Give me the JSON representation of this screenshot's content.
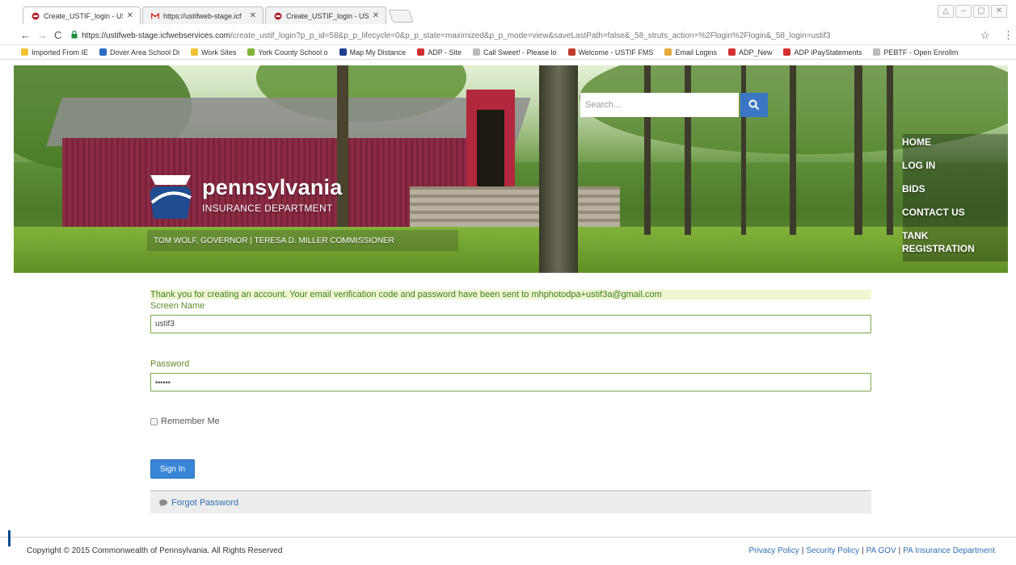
{
  "browser": {
    "tabs": [
      {
        "title": "Create_USTIF_login - UST",
        "icon": "site-favicon",
        "active": true
      },
      {
        "title": "https://ustifweb-stage.icf",
        "icon": "gmail-icon",
        "active": false
      },
      {
        "title": "Create_USTIF_login - UST",
        "icon": "site-favicon",
        "active": false
      }
    ],
    "url_host": "https://ustifweb-stage.icfwebservices.com",
    "url_path": "/create_ustif_login?p_p_id=58&p_p_lifecycle=0&p_p_state=maximized&p_p_mode=view&saveLastPath=false&_58_struts_action=%2Flogin%2Flogin&_58_login=ustif3",
    "bookmarks": [
      {
        "label": "Imported From IE",
        "color": "#f2c233"
      },
      {
        "label": "Dover Area School Di",
        "color": "#2b6cc4"
      },
      {
        "label": "Work Sites",
        "color": "#f2c233"
      },
      {
        "label": "York County School o",
        "color": "#7fb43a"
      },
      {
        "label": "Map My Distance",
        "color": "#1e3f8a"
      },
      {
        "label": "ADP - Site",
        "color": "#d32f2f"
      },
      {
        "label": "Call Sweet! - Please lo",
        "color": "#bbbbbb"
      },
      {
        "label": "Welcome - USTIF FMS",
        "color": "#c0392b"
      },
      {
        "label": "Email Logins",
        "color": "#e5a93c"
      },
      {
        "label": "ADP_New",
        "color": "#d32f2f"
      },
      {
        "label": "ADP iPayStatements",
        "color": "#d32f2f"
      },
      {
        "label": "PEBTF - Open Enrollm",
        "color": "#bbbbbb"
      }
    ]
  },
  "header": {
    "logo_word": "pennsylvania",
    "logo_sub": "INSURANCE DEPARTMENT",
    "governor_line": "TOM WOLF, GOVERNOR  |  TERESA D. MILLER COMMISSIONER",
    "search_placeholder": "Search...",
    "nav": [
      "HOME",
      "LOG IN",
      "BIDS",
      "CONTACT US",
      "TANK",
      "REGISTRATION"
    ]
  },
  "form": {
    "notice": "Thank you for creating an account. Your email verification code and password have been sent to mhphotodpa+ustif3a@gmail.com",
    "screen_name_label": "Screen Name",
    "screen_name_value": "ustif3",
    "password_label": "Password",
    "password_value": "••••••",
    "remember_label": "Remember Me",
    "signin_label": "Sign In",
    "forgot_label": "Forgot Password"
  },
  "footer": {
    "copyright": "Copyright © 2015 Commonwealth of Pennsylvania. All Rights Reserved",
    "links": [
      "Privacy Policy",
      "Security Policy",
      "PA GOV",
      "PA Insurance Department"
    ]
  },
  "colors": {
    "accent": "#3a86d6",
    "link": "#2e6fb5",
    "form_border": "#7aa84a",
    "notice_text": "#3f7f1e"
  }
}
